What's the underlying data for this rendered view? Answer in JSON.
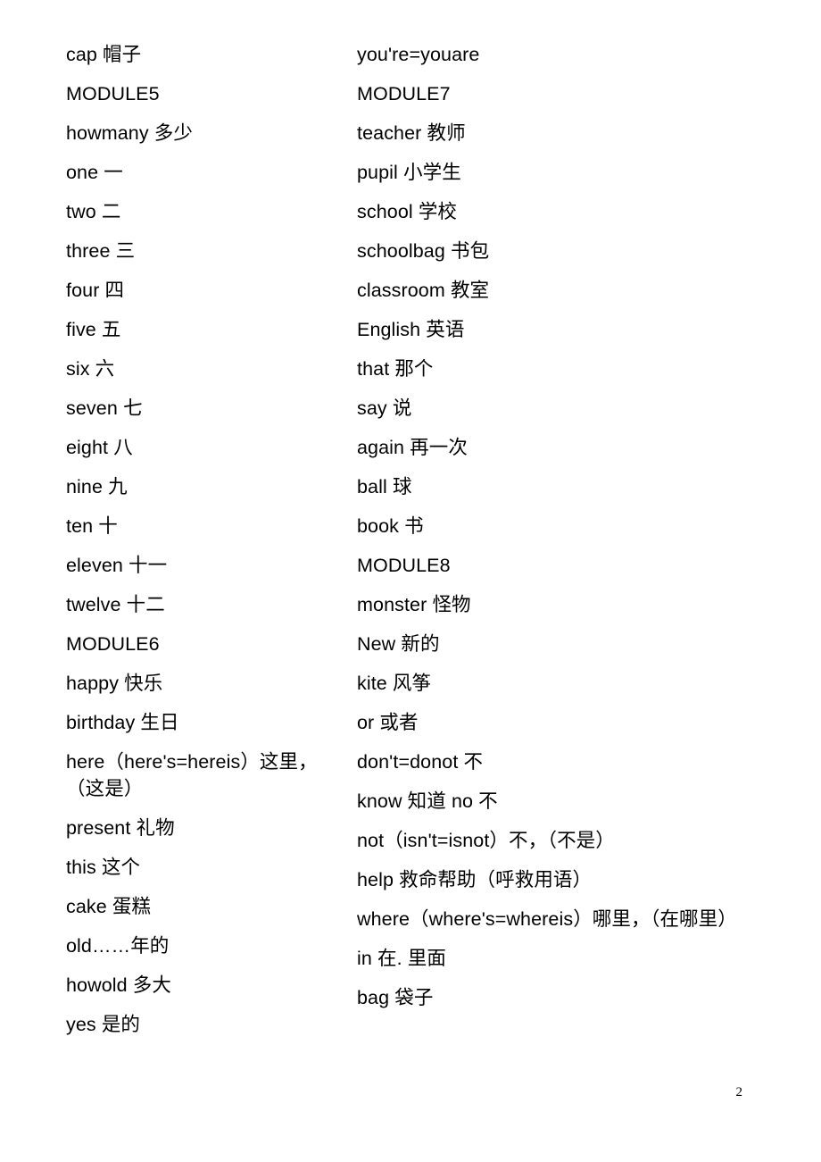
{
  "document": {
    "page_number": "2",
    "columns": {
      "left": {
        "entries": [
          "cap 帽子",
          "MODULE5",
          "howmany 多少",
          "one 一",
          "two 二",
          "three 三",
          "four 四",
          "five 五",
          "six 六",
          "seven 七",
          "eight 八",
          "nine 九",
          "ten 十",
          "eleven 十一",
          "twelve 十二",
          "MODULE6",
          "happy 快乐",
          "birthday 生日",
          "here（here's=hereis）这里，（这是）",
          "present 礼物",
          "this 这个",
          "cake 蛋糕",
          "old……年的",
          "howold 多大",
          "yes 是的"
        ]
      },
      "right": {
        "entries": [
          "you're=youare",
          "MODULE7",
          "teacher 教师",
          "pupil 小学生",
          "school 学校",
          "schoolbag 书包",
          "classroom 教室",
          "English 英语",
          "that 那个",
          "say 说",
          "again 再一次",
          "ball 球",
          "book 书",
          "MODULE8",
          "monster 怪物",
          "New 新的",
          "kite 风筝",
          "or 或者",
          "don't=donot 不",
          "know 知道 no 不",
          "not（isn't=isnot）不，（不是）",
          "help 救命帮助（呼救用语）",
          "where（where's=whereis）哪里，（在哪里）",
          "in 在. 里面",
          "bag 袋子"
        ]
      }
    }
  }
}
